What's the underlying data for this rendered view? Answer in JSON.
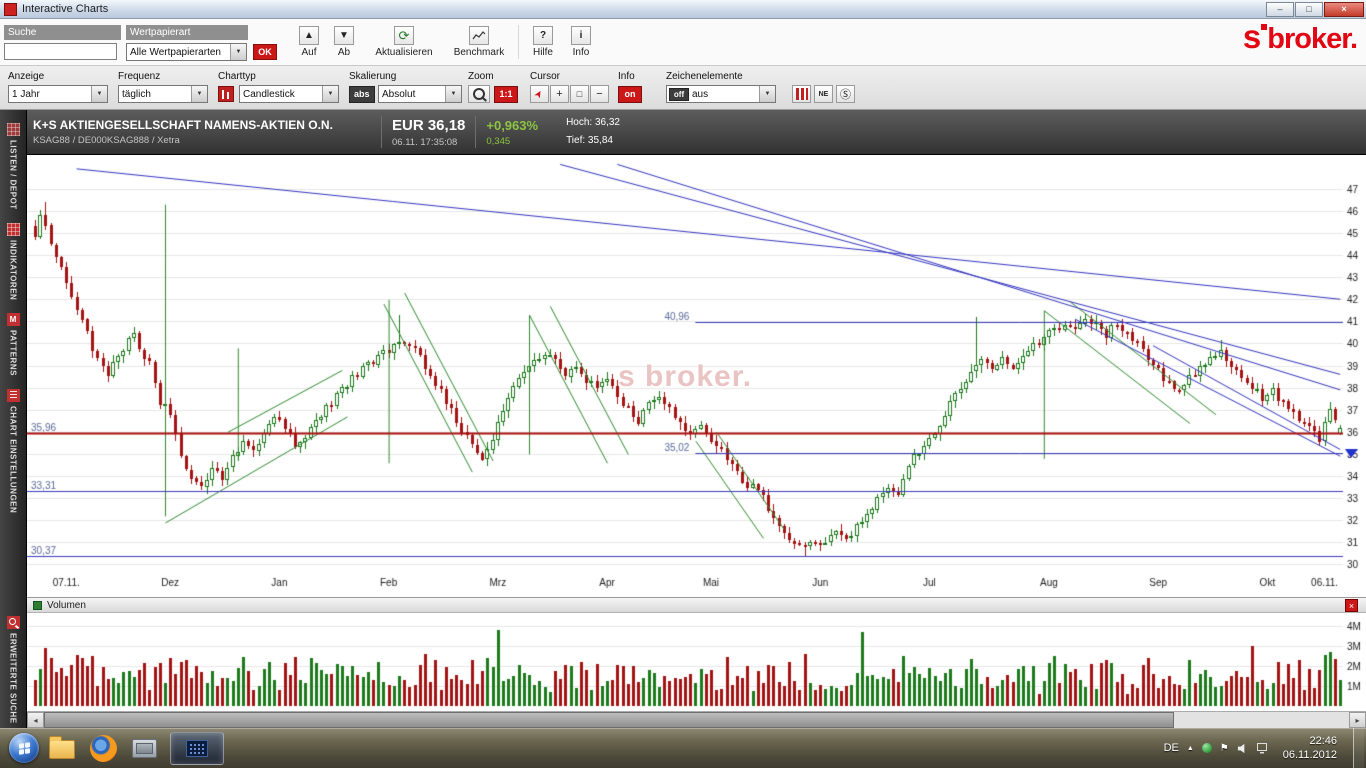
{
  "window": {
    "title": "Interactive Charts"
  },
  "theme": {
    "accent_red": "#cc1719",
    "up_green": "#8cc63f"
  },
  "logo": {
    "prefix": "s",
    "text": "broker.",
    "color": "#e30613"
  },
  "icons": {
    "minimize": "–",
    "maximize": "□",
    "close": "×",
    "dropdown_arrow": "▼",
    "up_arrow": "▲",
    "down_arrow": "▼",
    "refresh": "⟳",
    "help": "?",
    "info_i": "i",
    "pointer": "➤",
    "crosshair": "+",
    "select_box": "□",
    "minus": "−",
    "ne": "NE",
    "s_circle": "Ⓢ",
    "patterns_m": "M",
    "tray_expand": "▲",
    "flag": "⚑",
    "scroll_left": "◂",
    "scroll_right": "▸"
  },
  "toolbar1": {
    "search_label": "Suche",
    "search_value": "",
    "security_type_label": "Wertpapierart",
    "security_type_value": "Alle Wertpapierarten",
    "ok_label": "OK",
    "up_label": "Auf",
    "down_label": "Ab",
    "refresh_label": "Aktualisieren",
    "benchmark_label": "Benchmark",
    "help_label": "Hilfe",
    "info_label": "Info"
  },
  "toolbar2": {
    "display_label": "Anzeige",
    "display_value": "1 Jahr",
    "frequency_label": "Frequenz",
    "frequency_value": "täglich",
    "charttype_label": "Charttyp",
    "charttype_value": "Candlestick",
    "scaling_label": "Skalierung",
    "scaling_badge": "abs",
    "scaling_value": "Absolut",
    "zoom_label": "Zoom",
    "zoom_value": "1:1",
    "cursor_label": "Cursor",
    "info_label": "Info",
    "info_value": "on",
    "drawing_label": "Zeichenelemente",
    "drawing_badge": "off",
    "drawing_value": "aus"
  },
  "quote": {
    "name": "K+S AKTIENGESELLSCHAFT NAMENS-AKTIEN O.N.",
    "identifiers": "KSAG88 / DE000KSAG888 / Xetra",
    "price": "EUR 36,18",
    "timestamp": "06.11. 17:35:08",
    "change_percent": "+0,963%",
    "change_abs": "0,345",
    "high_label": "Hoch: 36,32",
    "low_label": "Tief: 35,84"
  },
  "sidebar": {
    "items": [
      {
        "label": "LISTEN / DEPOT"
      },
      {
        "label": "INDIKATOREN"
      },
      {
        "label": "PATTERNS"
      },
      {
        "label": "CHART EINSTELLUNGEN"
      },
      {
        "label": "ERWEITERTE SUCHE"
      }
    ]
  },
  "chart_data": {
    "type": "candlestick",
    "title": "K+S Aktiengesellschaft — 1 Jahr, täglich",
    "watermark": "s broker.",
    "ylim": [
      29.3,
      48.2
    ],
    "yticks": [
      30,
      31,
      32,
      33,
      34,
      35,
      36,
      37,
      38,
      39,
      40,
      41,
      42,
      43,
      44,
      45,
      46,
      47
    ],
    "days": 252,
    "x_labels": [
      {
        "label": "07.11.",
        "day": 6
      },
      {
        "label": "Dez",
        "day": 26
      },
      {
        "label": "Jan",
        "day": 47
      },
      {
        "label": "Feb",
        "day": 68
      },
      {
        "label": "Mrz",
        "day": 89
      },
      {
        "label": "Apr",
        "day": 110
      },
      {
        "label": "Mai",
        "day": 130
      },
      {
        "label": "Jun",
        "day": 151
      },
      {
        "label": "Jul",
        "day": 172
      },
      {
        "label": "Aug",
        "day": 195
      },
      {
        "label": "Sep",
        "day": 216
      },
      {
        "label": "Okt",
        "day": 237
      },
      {
        "label": "06.11.",
        "day": 248
      }
    ],
    "price_anchors": [
      [
        0,
        45.0
      ],
      [
        1,
        46.0
      ],
      [
        3,
        44.6
      ],
      [
        6,
        42.8
      ],
      [
        9,
        40.9
      ],
      [
        12,
        39.3
      ],
      [
        14,
        38.4
      ],
      [
        16,
        39.6
      ],
      [
        19,
        40.3
      ],
      [
        22,
        39.0
      ],
      [
        24,
        37.4
      ],
      [
        26,
        36.8
      ],
      [
        28,
        35.0
      ],
      [
        30,
        33.9
      ],
      [
        32,
        33.5
      ],
      [
        34,
        34.3
      ],
      [
        36,
        34.0
      ],
      [
        38,
        34.9
      ],
      [
        40,
        35.4
      ],
      [
        42,
        35.1
      ],
      [
        44,
        36.0
      ],
      [
        46,
        36.6
      ],
      [
        48,
        36.2
      ],
      [
        50,
        35.4
      ],
      [
        52,
        35.9
      ],
      [
        54,
        36.5
      ],
      [
        56,
        37.1
      ],
      [
        58,
        37.6
      ],
      [
        60,
        38.2
      ],
      [
        62,
        38.6
      ],
      [
        64,
        39.0
      ],
      [
        66,
        39.4
      ],
      [
        68,
        39.7
      ],
      [
        70,
        40.2
      ],
      [
        72,
        40.0
      ],
      [
        74,
        39.4
      ],
      [
        76,
        38.6
      ],
      [
        78,
        37.8
      ],
      [
        80,
        37.0
      ],
      [
        82,
        36.1
      ],
      [
        84,
        35.3
      ],
      [
        86,
        34.9
      ],
      [
        88,
        35.8
      ],
      [
        90,
        37.0
      ],
      [
        92,
        38.2
      ],
      [
        94,
        38.8
      ],
      [
        96,
        39.1
      ],
      [
        98,
        39.5
      ],
      [
        100,
        39.2
      ],
      [
        102,
        38.6
      ],
      [
        104,
        39.0
      ],
      [
        106,
        38.4
      ],
      [
        108,
        37.9
      ],
      [
        110,
        38.3
      ],
      [
        112,
        37.6
      ],
      [
        114,
        37.0
      ],
      [
        116,
        36.5
      ],
      [
        118,
        37.2
      ],
      [
        120,
        37.7
      ],
      [
        122,
        37.1
      ],
      [
        124,
        36.4
      ],
      [
        126,
        35.9
      ],
      [
        128,
        36.3
      ],
      [
        130,
        35.7
      ],
      [
        132,
        35.1
      ],
      [
        134,
        34.4
      ],
      [
        136,
        33.8
      ],
      [
        138,
        33.5
      ],
      [
        140,
        33.0
      ],
      [
        142,
        32.2
      ],
      [
        144,
        31.4
      ],
      [
        146,
        30.9
      ],
      [
        148,
        30.7
      ],
      [
        150,
        31.1
      ],
      [
        152,
        30.9
      ],
      [
        154,
        31.4
      ],
      [
        156,
        31.2
      ],
      [
        158,
        31.7
      ],
      [
        160,
        32.3
      ],
      [
        162,
        33.0
      ],
      [
        164,
        33.5
      ],
      [
        166,
        33.2
      ],
      [
        168,
        34.6
      ],
      [
        170,
        35.0
      ],
      [
        172,
        35.6
      ],
      [
        174,
        36.4
      ],
      [
        176,
        37.2
      ],
      [
        178,
        38.1
      ],
      [
        180,
        38.8
      ],
      [
        182,
        39.2
      ],
      [
        184,
        38.9
      ],
      [
        186,
        39.3
      ],
      [
        188,
        39.0
      ],
      [
        190,
        39.6
      ],
      [
        192,
        39.9
      ],
      [
        194,
        40.3
      ],
      [
        196,
        40.6
      ],
      [
        198,
        40.9
      ],
      [
        200,
        40.7
      ],
      [
        202,
        41.0
      ],
      [
        204,
        40.8
      ],
      [
        206,
        40.4
      ],
      [
        208,
        40.9
      ],
      [
        210,
        40.5
      ],
      [
        212,
        40.0
      ],
      [
        214,
        39.4
      ],
      [
        216,
        38.8
      ],
      [
        218,
        38.2
      ],
      [
        220,
        37.9
      ],
      [
        222,
        38.4
      ],
      [
        224,
        38.9
      ],
      [
        226,
        39.2
      ],
      [
        228,
        39.6
      ],
      [
        230,
        39.0
      ],
      [
        232,
        38.5
      ],
      [
        234,
        38.0
      ],
      [
        236,
        37.6
      ],
      [
        238,
        37.9
      ],
      [
        240,
        37.3
      ],
      [
        242,
        36.8
      ],
      [
        244,
        36.4
      ],
      [
        246,
        36.0
      ],
      [
        247,
        35.7
      ],
      [
        248,
        36.3
      ],
      [
        249,
        36.9
      ],
      [
        250,
        36.5
      ],
      [
        251,
        36.2
      ]
    ],
    "wick_spikes": [
      {
        "day": 2,
        "high": 46.4
      },
      {
        "day": 70,
        "high": 41.3
      },
      {
        "day": 148,
        "low": 30.37
      },
      {
        "day": 181,
        "high": 41.2
      },
      {
        "day": 202,
        "high": 41.35
      },
      {
        "day": 228,
        "high": 40.15
      },
      {
        "day": 247,
        "low": 35.35
      }
    ],
    "last_candle": {
      "open": 35.9,
      "close": 36.18,
      "high": 36.32,
      "low": 35.84
    },
    "levels": [
      {
        "price": 35.96,
        "label": "35,96",
        "color": "#aa1111",
        "from_day": 0,
        "label_at": "left",
        "width": 2
      },
      {
        "price": 40.96,
        "label": "40,96",
        "color": "#3b3bbf",
        "from_day": 127,
        "label_at": "start",
        "width": 1
      },
      {
        "price": 35.02,
        "label": "35,02",
        "color": "#3b3bbf",
        "from_day": 127,
        "label_at": "start",
        "width": 1
      },
      {
        "price": 33.31,
        "label": "33,31",
        "color": "#3b3bbf",
        "from_day": 0,
        "label_at": "left",
        "width": 1
      },
      {
        "price": 30.37,
        "label": "30,37",
        "color": "#3b3bbf",
        "from_day": 0,
        "label_at": "left",
        "width": 1
      }
    ],
    "trendlines": [
      {
        "from": [
          8,
          47.9
        ],
        "to": [
          251,
          42.0
        ]
      },
      {
        "from": [
          101,
          48.1
        ],
        "to": [
          251,
          38.6
        ]
      },
      {
        "from": [
          112,
          48.1
        ],
        "to": [
          251,
          37.9
        ]
      },
      {
        "from": [
          200,
          41.1
        ],
        "to": [
          251,
          34.9
        ]
      },
      {
        "from": [
          215,
          39.9
        ],
        "to": [
          251,
          35.2
        ]
      }
    ],
    "green_segments": [
      [
        [
          25,
          46.3
        ],
        [
          25,
          32.2
        ]
      ],
      [
        [
          25,
          31.9
        ],
        [
          60,
          36.7
        ]
      ],
      [
        [
          37,
          36.0
        ],
        [
          59,
          38.8
        ]
      ],
      [
        [
          39,
          39.8
        ],
        [
          39,
          34.7
        ]
      ],
      [
        [
          68,
          42.0
        ],
        [
          68,
          34.6
        ]
      ],
      [
        [
          67,
          41.8
        ],
        [
          84,
          34.2
        ]
      ],
      [
        [
          71,
          42.3
        ],
        [
          88,
          34.7
        ]
      ],
      [
        [
          95,
          41.3
        ],
        [
          95,
          35.0
        ]
      ],
      [
        [
          95,
          41.3
        ],
        [
          110,
          34.6
        ]
      ],
      [
        [
          99,
          41.7
        ],
        [
          114,
          35.0
        ]
      ],
      [
        [
          127,
          35.6
        ],
        [
          140,
          31.2
        ]
      ],
      [
        [
          131,
          36.0
        ],
        [
          144,
          31.6
        ]
      ],
      [
        [
          194,
          41.5
        ],
        [
          194,
          34.8
        ]
      ],
      [
        [
          194,
          41.5
        ],
        [
          222,
          36.4
        ]
      ],
      [
        [
          199,
          41.9
        ],
        [
          227,
          36.8
        ]
      ]
    ],
    "marker": {
      "price": 35.02,
      "color": "#2233cc"
    },
    "colors": {
      "up": "#1d7a1d",
      "down": "#a31515",
      "grid": "#e7e7e7",
      "trend": "#3434c0",
      "draw": "#2f8a2f"
    }
  },
  "volume": {
    "title": "Volumen",
    "ylim": [
      0,
      4
    ],
    "yticks": [
      {
        "value": 4,
        "label": "4M"
      },
      {
        "value": 3,
        "label": "3M"
      },
      {
        "value": 2,
        "label": "2M"
      },
      {
        "value": 1,
        "label": "1M"
      }
    ],
    "spikes": [
      [
        2,
        2.9
      ],
      [
        26,
        2.4
      ],
      [
        89,
        3.8
      ],
      [
        148,
        2.6
      ],
      [
        159,
        3.7
      ],
      [
        196,
        2.5
      ],
      [
        234,
        3.0
      ],
      [
        249,
        2.7
      ]
    ]
  },
  "taskbar": {
    "language": "DE",
    "time": "22:46",
    "date": "06.11.2012"
  }
}
